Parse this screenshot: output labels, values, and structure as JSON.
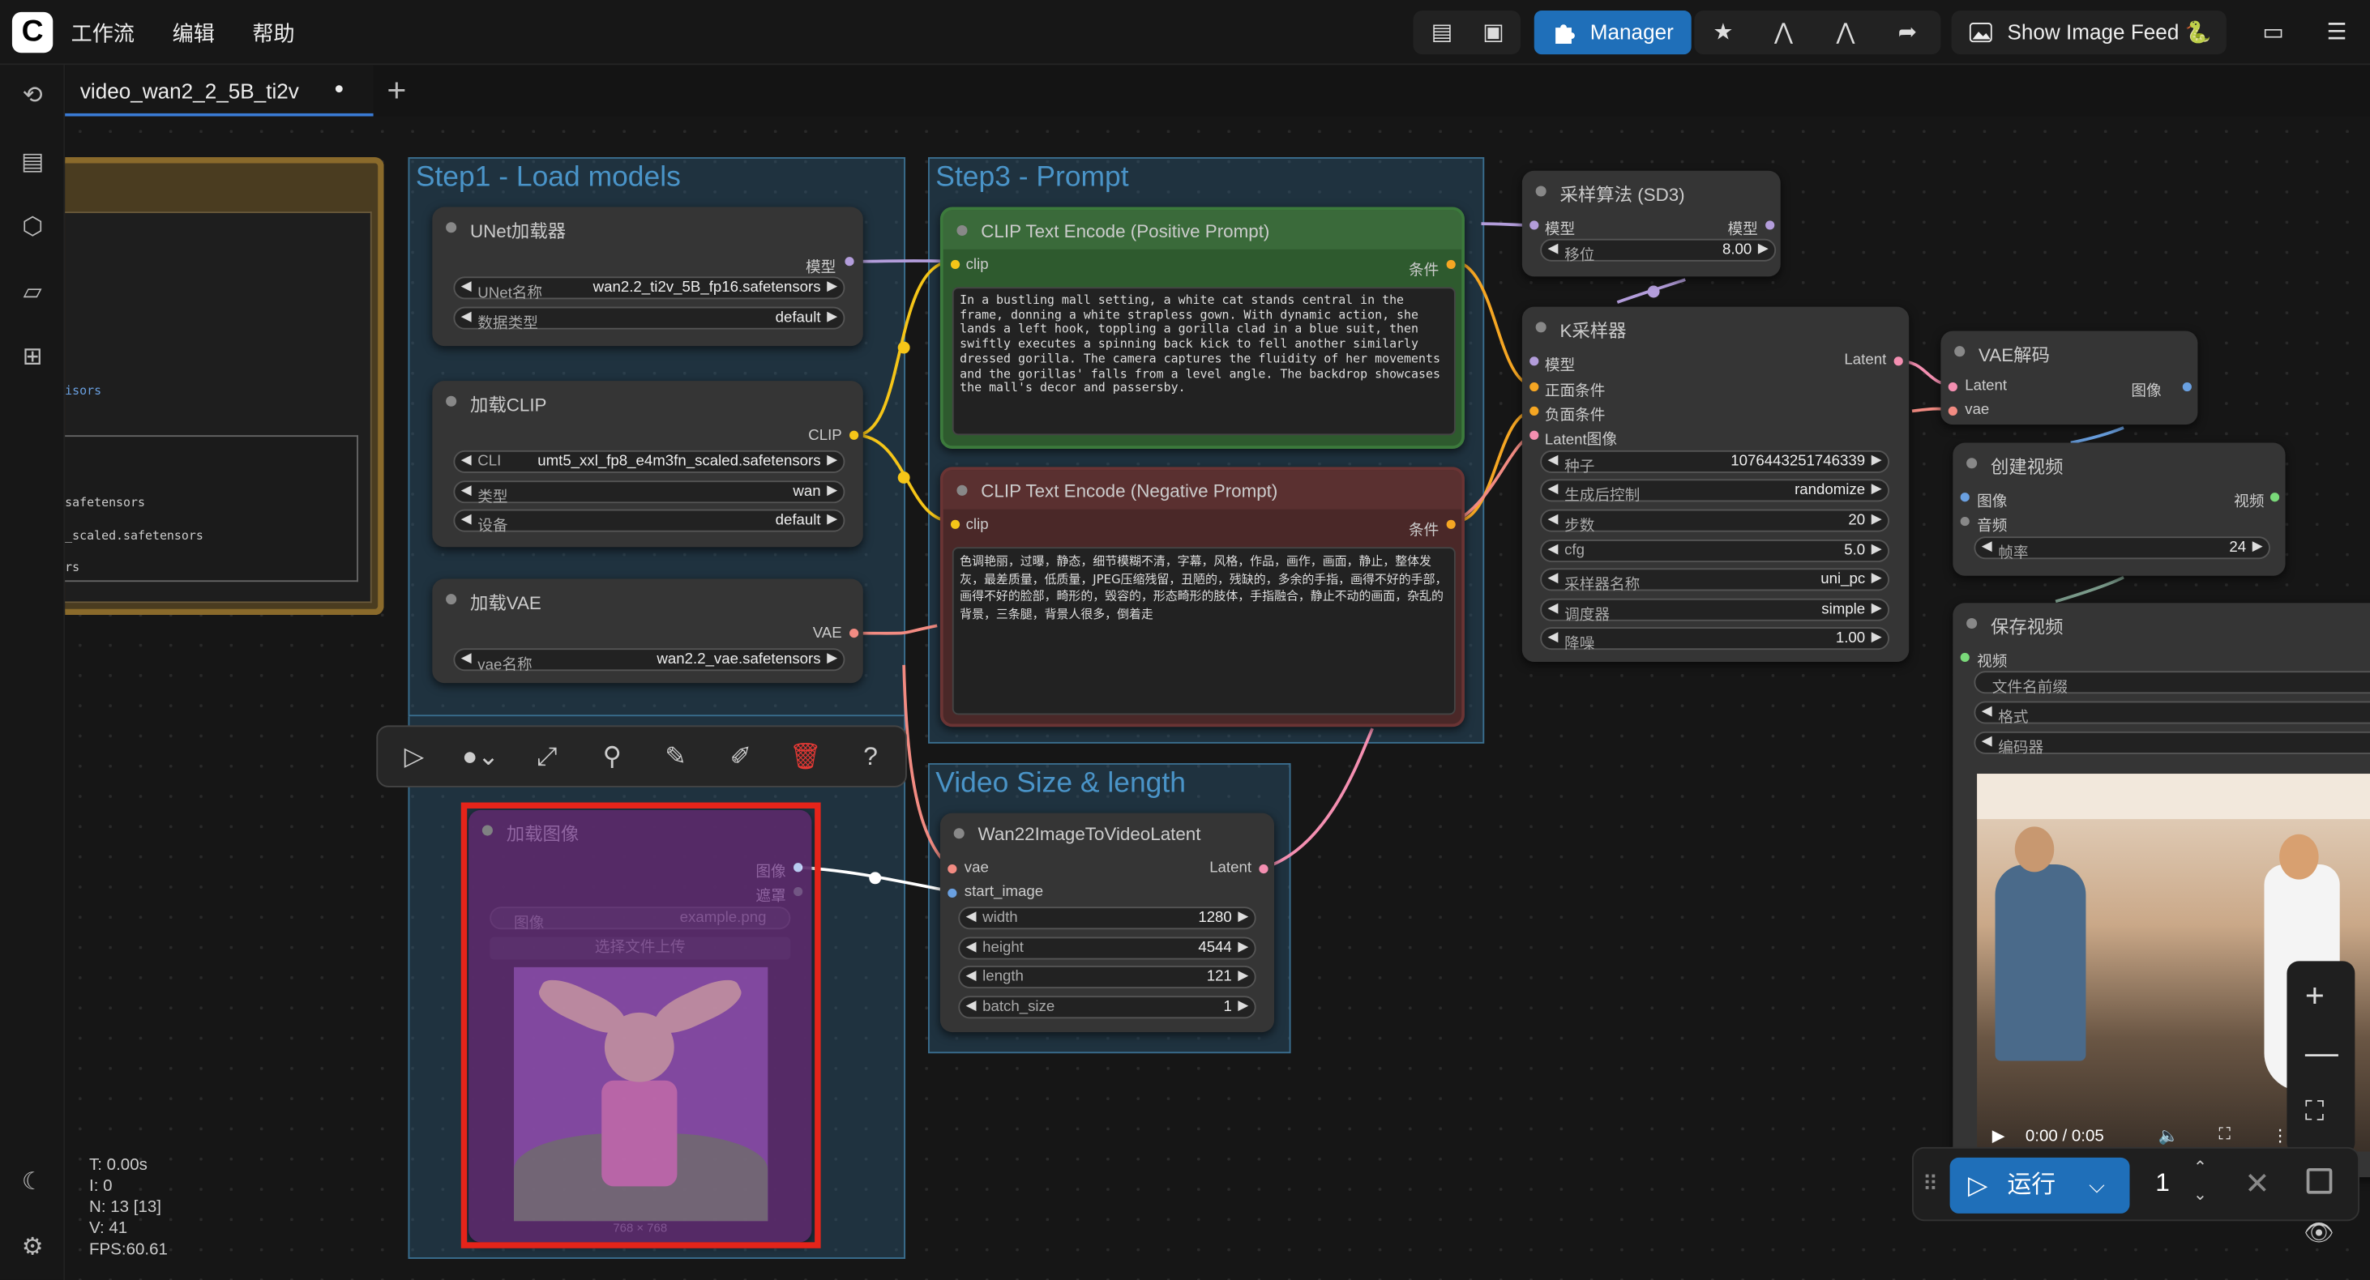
{
  "topbar": {
    "logo": "C",
    "menu": [
      "工作流",
      "编辑",
      "帮助"
    ],
    "manager_label": "Manager",
    "show_image_feed": "Show Image Feed 🐍"
  },
  "tab": {
    "title": "video_wan2_2_5B_ti2v",
    "modified_dot": "●",
    "add": "+"
  },
  "groups": {
    "step1": "Step1 - Load models",
    "step3": "Step3 - Prompt",
    "video_size": "Video Size & length"
  },
  "left_panel": {
    "lines": [
      "isors",
      "safetensors",
      "_scaled.safetensors",
      "rs"
    ]
  },
  "nodes": {
    "unet": {
      "title": "UNet加载器",
      "out": "模型",
      "w1_label": "UNet名称",
      "w1_value": "wan2.2_ti2v_5B_fp16.safetensors",
      "w2_label": "数据类型",
      "w2_value": "default"
    },
    "clip": {
      "title": "加载CLIP",
      "out": "CLIP",
      "w1_label": "CLI",
      "w1_value": "umt5_xxl_fp8_e4m3fn_scaled.safetensors",
      "w2_label": "类型",
      "w2_value": "wan",
      "w3_label": "设备",
      "w3_value": "default"
    },
    "vae": {
      "title": "加载VAE",
      "out": "VAE",
      "w1_label": "vae名称",
      "w1_value": "wan2.2_vae.safetensors"
    },
    "pos": {
      "title": "CLIP Text Encode (Positive Prompt)",
      "in": "clip",
      "out": "条件",
      "text": "In a bustling mall setting, a white cat stands central in the frame, donning a white strapless gown. With dynamic action, she lands a left hook, toppling a gorilla clad in a blue suit, then swiftly executes a spinning back kick to fell another similarly dressed gorilla. The camera captures the fluidity of her movements and the gorillas' falls from a level angle. The backdrop showcases the mall's decor and passersby."
    },
    "neg": {
      "title": "CLIP Text Encode (Negative Prompt)",
      "in": "clip",
      "out": "条件",
      "text": "色调艳丽，过曝，静态，细节模糊不清，字幕，风格，作品，画作，画面，静止，整体发灰，最差质量，低质量，JPEG压缩残留，丑陋的，残缺的，多余的手指，画得不好的手部，画得不好的脸部，畸形的，毁容的，形态畸形的肢体，手指融合，静止不动的画面，杂乱的背景，三条腿，背景人很多，倒着走"
    },
    "sampling": {
      "title": "采样算法 (SD3)",
      "in": "模型",
      "out": "模型",
      "w1_label": "移位",
      "w1_value": "8.00"
    },
    "ksampler": {
      "title": "K采样器",
      "in1": "模型",
      "in2": "正面条件",
      "in3": "负面条件",
      "in4": "Latent图像",
      "out": "Latent",
      "widgets": [
        {
          "l": "种子",
          "v": "1076443251746339"
        },
        {
          "l": "生成后控制",
          "v": "randomize"
        },
        {
          "l": "步数",
          "v": "20"
        },
        {
          "l": "cfg",
          "v": "5.0"
        },
        {
          "l": "采样器名称",
          "v": "uni_pc"
        },
        {
          "l": "调度器",
          "v": "simple"
        },
        {
          "l": "降噪",
          "v": "1.00"
        }
      ]
    },
    "vaedecode": {
      "title": "VAE解码",
      "in1": "Latent",
      "in2": "vae",
      "out": "图像"
    },
    "createvideo": {
      "title": "创建视频",
      "in1": "图像",
      "in2": "音频",
      "out": "视频",
      "w1_label": "帧率",
      "w1_value": "24"
    },
    "savevideo": {
      "title": "保存视频",
      "in": "视频",
      "w1_label": "文件名前缀",
      "w2_label": "格式",
      "w3_label": "编码器",
      "time": "0:00 / 0:05"
    },
    "wan22": {
      "title": "Wan22ImageToVideoLatent",
      "in1": "vae",
      "in2": "start_image",
      "out": "Latent",
      "widgets": [
        {
          "l": "width",
          "v": "1280"
        },
        {
          "l": "height",
          "v": "4544"
        },
        {
          "l": "length",
          "v": "121"
        },
        {
          "l": "batch_size",
          "v": "1"
        }
      ]
    },
    "loadimage": {
      "title": "加载图像",
      "out1": "图像",
      "out2": "遮罩",
      "w1_label": "图像",
      "w1_value": "example.png",
      "upload": "选择文件上传",
      "dims": "768 × 768"
    }
  },
  "runbar": {
    "run_label": "运行",
    "count": "1"
  },
  "stats": [
    "T: 0.00s",
    "I: 0",
    "N: 13 [13]",
    "V: 41",
    "FPS:60.61"
  ],
  "colors": {
    "accent": "#1f6fb9",
    "group": "#30688d",
    "highlight": "#e5241a"
  }
}
